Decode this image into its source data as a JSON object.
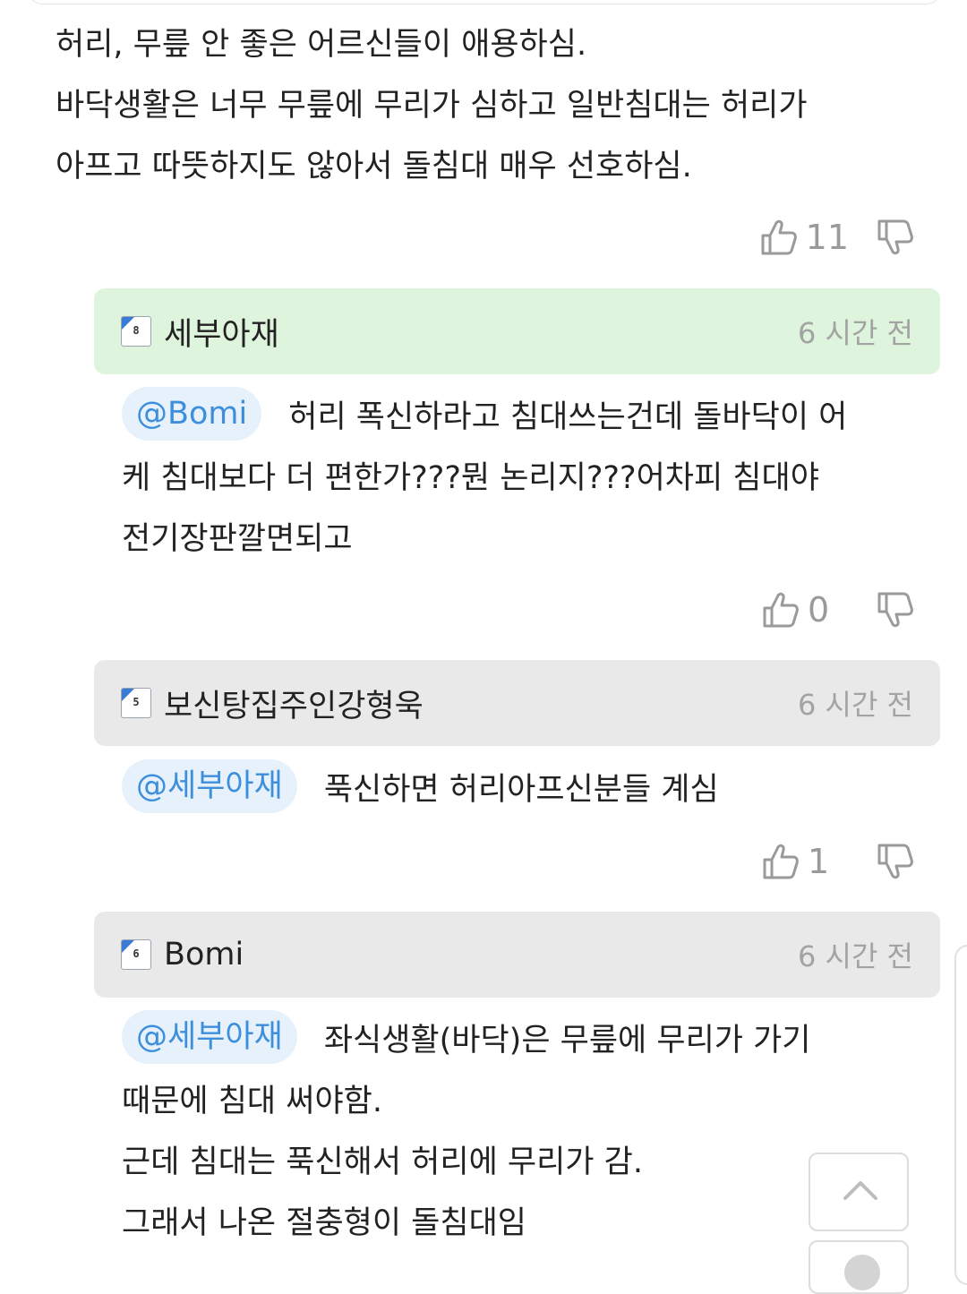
{
  "root_comment": {
    "lines": [
      "허리, 무릎 안 좋은 어르신들이 애용하심.",
      "바닥생활은 너무 무릎에 무리가 심하고 일반침대는 허리가",
      "아프고 따뜻하지도 않아서 돌침대 매우 선호하심."
    ],
    "likes": "11",
    "like_icon": "thumbs-up-icon",
    "dislike_icon": "thumbs-down-icon"
  },
  "replies": [
    {
      "author": "세부아재",
      "level": "8",
      "time": "6 시간 전",
      "header_color": "#dff4dc",
      "mention": "@Bomi",
      "lines": [
        "허리 폭신하라고 침대쓰는건데 돌바닥이 어",
        "케 침대보다 더 편한가???뭔 논리지???어차피 침대야",
        "전기장판깔면되고"
      ],
      "likes": "0"
    },
    {
      "author": "보신탕집주인강형욱",
      "level": "5",
      "time": "6 시간 전",
      "header_color": "#e9e9ea",
      "mention": "@세부아재",
      "lines": [
        "푹신하면 허리아프신분들 계심"
      ],
      "likes": "1"
    },
    {
      "author": "Bomi",
      "level": "6",
      "time": "6 시간 전",
      "header_color": "#e9e9ea",
      "mention": "@세부아재",
      "lines": [
        "좌식생활(바닥)은 무릎에 무리가 가기",
        "때문에 침대 써야함.",
        "근데 침대는 푹신해서 허리에 무리가 감.",
        "그래서 나온 절충형이 돌침대임"
      ]
    }
  ],
  "colors": {
    "mention_text": "#3d8fdc",
    "mention_bg": "#e6f1fb",
    "time": "#a3a3a3",
    "count": "#9a9a9a"
  },
  "scroll_top_icon": "chevron-up-icon"
}
